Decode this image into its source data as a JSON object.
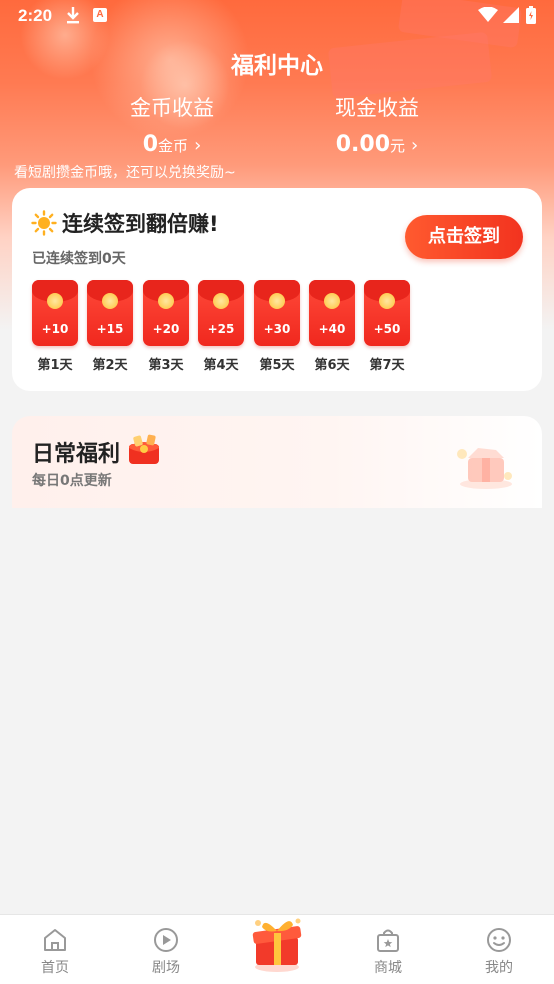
{
  "status_bar": {
    "time": "2:20",
    "icons": [
      "download-icon",
      "a-badge-icon",
      "wifi-icon",
      "signal-icon",
      "battery-icon"
    ],
    "a_badge": "A"
  },
  "header": {
    "title": "福利中心",
    "coin": {
      "label": "金币收益",
      "value": "0",
      "unit": "金币",
      "chevron": "›"
    },
    "cash": {
      "label": "现金收益",
      "value": "0.00",
      "unit": "元",
      "chevron": "›"
    },
    "hint": "看短剧攒金币哦，还可以兑换奖励~"
  },
  "sign_in": {
    "title": "连续签到翻倍赚!",
    "subtitle": "已连续签到0天",
    "button": "点击签到",
    "days": [
      {
        "label": "第1天",
        "amount": "+10"
      },
      {
        "label": "第2天",
        "amount": "+15"
      },
      {
        "label": "第3天",
        "amount": "+20"
      },
      {
        "label": "第4天",
        "amount": "+25"
      },
      {
        "label": "第5天",
        "amount": "+30"
      },
      {
        "label": "第6天",
        "amount": "+40"
      },
      {
        "label": "第7天",
        "amount": "+50"
      }
    ]
  },
  "daily": {
    "title": "日常福利",
    "subtitle": "每日0点更新"
  },
  "bottom_nav": {
    "items": [
      {
        "label": "首页",
        "icon": "home-icon"
      },
      {
        "label": "剧场",
        "icon": "play-icon"
      },
      {
        "label": "",
        "icon": "gift-icon"
      },
      {
        "label": "商城",
        "icon": "shop-bag-icon"
      },
      {
        "label": "我的",
        "icon": "smile-face-icon"
      }
    ]
  },
  "colors": {
    "accent": "#ff6a3d",
    "button": "#f2331f",
    "envelope": "#f0281e",
    "background": "#f3f3f3"
  }
}
